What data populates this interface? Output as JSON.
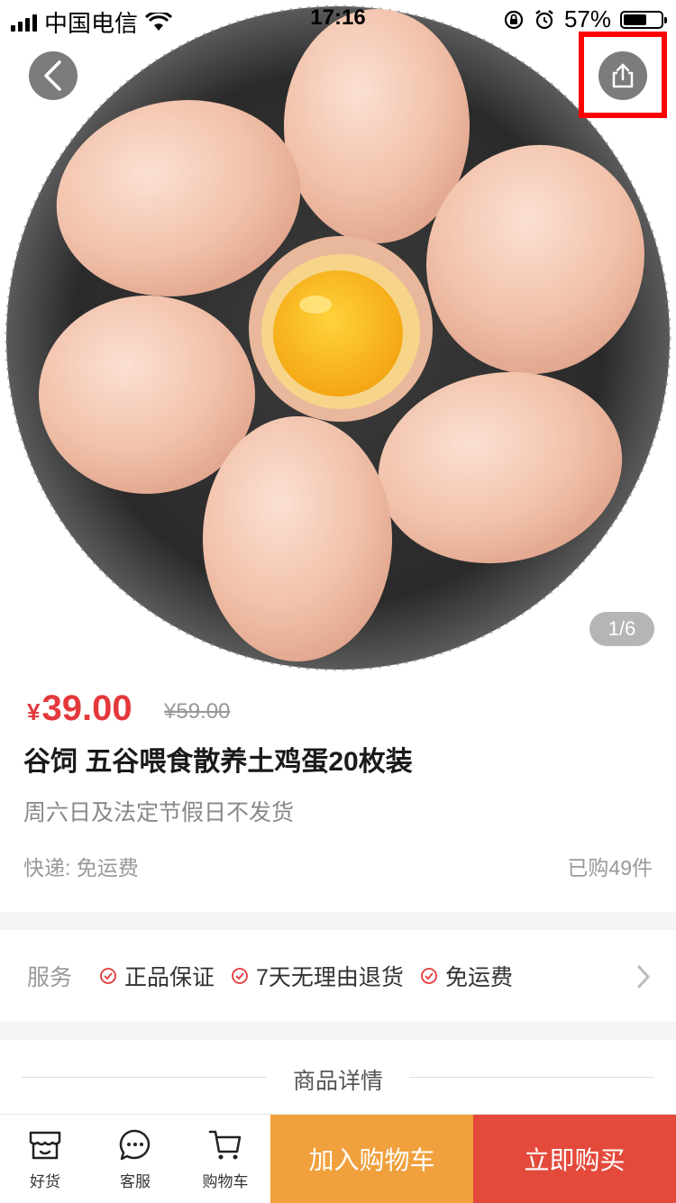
{
  "status_bar": {
    "carrier": "中国电信",
    "time": "17:16",
    "battery": "57%"
  },
  "gallery": {
    "pager": "1/6"
  },
  "product": {
    "currency": "¥",
    "price": "39.00",
    "original_price": "¥59.00",
    "title": "谷饲 五谷喂食散养土鸡蛋20枚装",
    "note": "周六日及法定节假日不发货",
    "shipping": "快递: 免运费",
    "sold": "已购49件"
  },
  "service": {
    "label": "服务",
    "items": [
      "正品保证",
      "7天无理由退货",
      "免运费"
    ]
  },
  "details": {
    "title": "商品详情"
  },
  "bottom_bar": {
    "tabs": [
      {
        "label": "好货",
        "icon": "store-icon"
      },
      {
        "label": "客服",
        "icon": "chat-icon"
      },
      {
        "label": "购物车",
        "icon": "cart-icon"
      }
    ],
    "add_to_cart": "加入购物车",
    "buy_now": "立即购买"
  },
  "colors": {
    "accent_red": "#e4393c",
    "cart_orange": "#f0a03c",
    "buy_red": "#e44a3c",
    "highlight": "#ff0000"
  }
}
